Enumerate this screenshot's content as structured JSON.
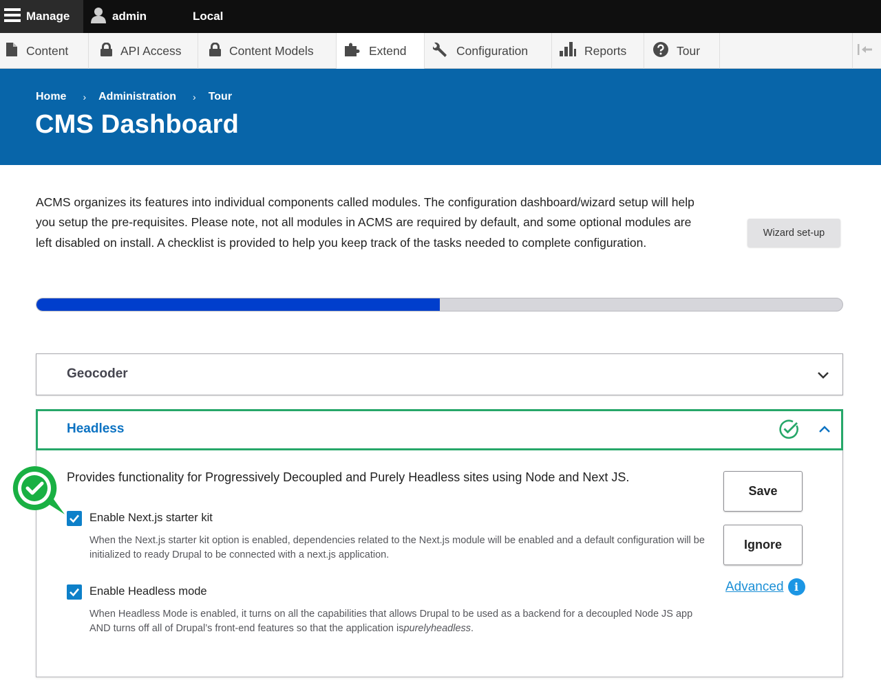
{
  "toolbar": {
    "manage_label": "Manage",
    "user_label": "admin",
    "environment_label": "Local"
  },
  "tray": {
    "items": [
      {
        "label": "Content",
        "icon": "file-icon"
      },
      {
        "label": "API Access",
        "icon": "lock-icon"
      },
      {
        "label": "Content Models",
        "icon": "lock-icon"
      },
      {
        "label": "Extend",
        "icon": "puzzle-icon"
      },
      {
        "label": "Configuration",
        "icon": "wrench-icon"
      },
      {
        "label": "Reports",
        "icon": "bar-chart-icon"
      },
      {
        "label": "Tour",
        "icon": "question-icon"
      }
    ]
  },
  "breadcrumb": [
    "Home",
    "Administration",
    "Tour"
  ],
  "page": {
    "title": "CMS Dashboard",
    "intro": "ACMS organizes its features into individual components called modules. The configuration dashboard/wizard setup will help you setup the pre-requisites. Please note, not all modules in ACMS are required by default, and some optional modules are left disabled on install. A checklist is provided to help you keep track of the tasks needed to complete configuration.",
    "wizard_button": "Wizard set-up",
    "progress_fraction": 0.5
  },
  "accordions": {
    "geocoder": {
      "title": "Geocoder"
    },
    "headless": {
      "title": "Headless",
      "description": "Provides functionality for Progressively Decoupled and Purely Headless sites using Node and Next JS.",
      "options": [
        {
          "label": "Enable Next.js starter kit",
          "checked": true,
          "help": "When the Next.js starter kit option is enabled, dependencies related to the Next.js module will be enabled and a default configuration will be initialized to ready Drupal to be connected with a next.js application."
        },
        {
          "label": "Enable Headless mode",
          "checked": true,
          "help_prefix": "When Headless Mode is enabled, it turns on all the capabilities that allows Drupal to be used as a backend for a decoupled Node JS app AND turns off all of Drupal’s front-end features so that the application is",
          "help_emphasis": "purelyheadless",
          "help_suffix": "."
        }
      ],
      "save_label": "Save",
      "ignore_label": "Ignore",
      "advanced_label": "Advanced"
    }
  },
  "colors": {
    "banner": "#0865a9",
    "progress_fill": "#003ecc",
    "success": "#26a769",
    "link": "#1b8fd6"
  }
}
